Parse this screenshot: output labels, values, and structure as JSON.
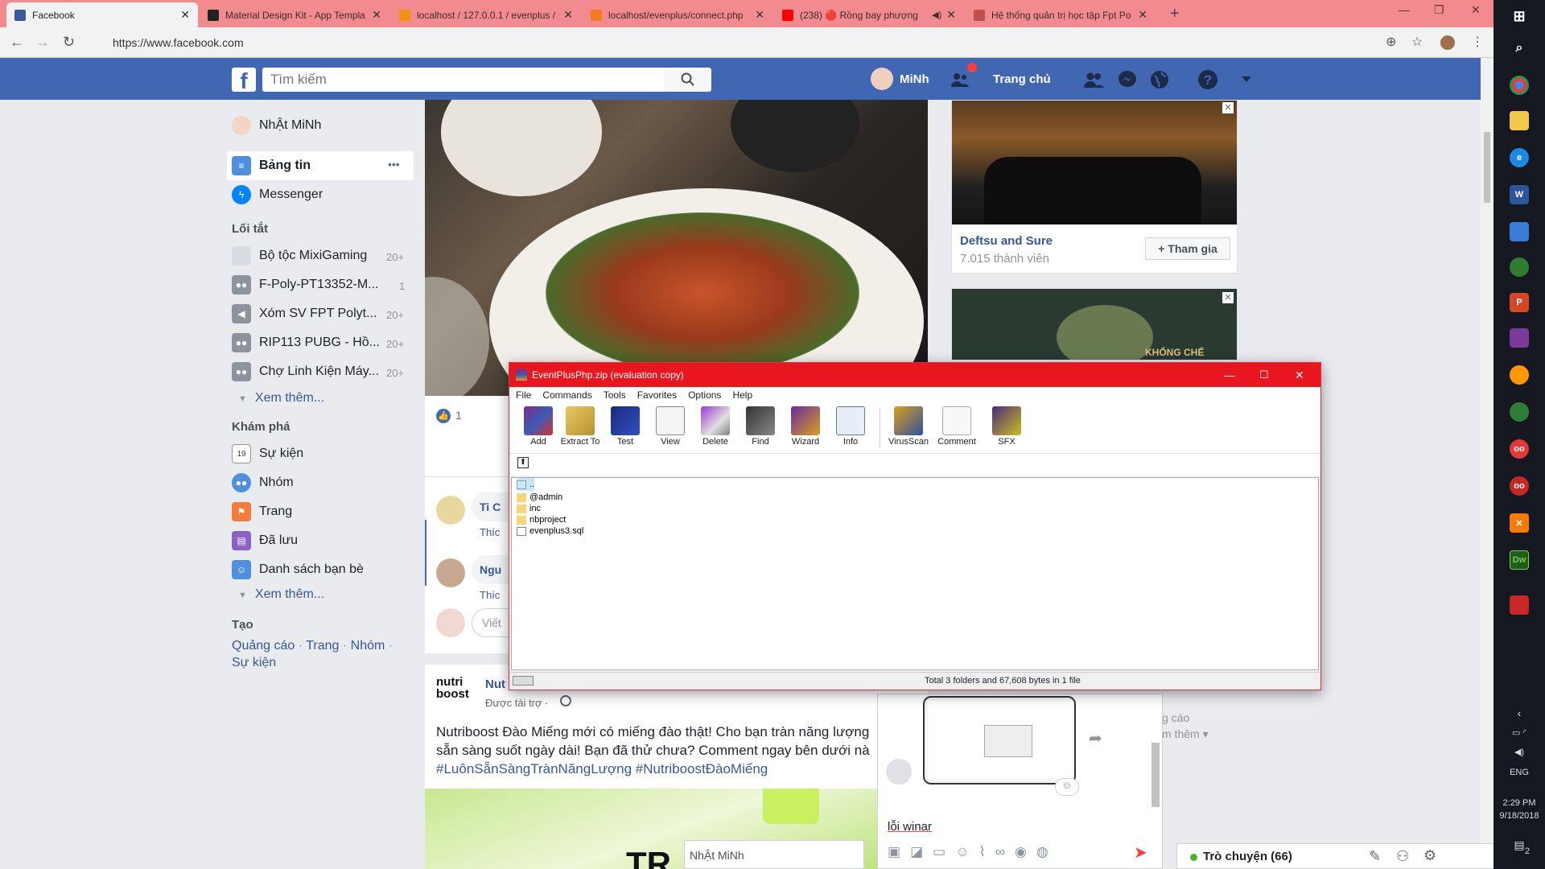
{
  "browser": {
    "tabs": [
      {
        "title": "Facebook",
        "color": "#3b5998"
      },
      {
        "title": "Material Design Kit - App Templa",
        "color": "#222222"
      },
      {
        "title": "localhost / 127.0.0.1 / evenplus /",
        "color": "#f29111"
      },
      {
        "title": "localhost/evenplus/connect.php",
        "color": "#f47b20"
      },
      {
        "title": "(238) 🔴 Rồng bay phượng",
        "color": "#ff0000"
      },
      {
        "title": "Hệ thống quản trị học tập Fpt Po",
        "color": "#c0504d"
      }
    ],
    "url": "https://www.facebook.com"
  },
  "fb_header": {
    "logo": "f",
    "search_placeholder": "Tìm kiếm",
    "user_name": "MiNh",
    "home": "Trang chủ"
  },
  "sidebar": {
    "profile_name": "NhẬt MiNh",
    "main_items": [
      {
        "label": "Bảng tin",
        "icon": "news-feed-icon"
      },
      {
        "label": "Messenger",
        "icon": "messenger-icon"
      }
    ],
    "more_dots": "•••",
    "shortcuts_title": "Lối tắt",
    "shortcuts": [
      {
        "label": "Bộ tộc MixiGaming",
        "count": "20+"
      },
      {
        "label": "F-Poly-PT13352-M...",
        "count": "1"
      },
      {
        "label": "Xóm SV FPT Polyt...",
        "count": "20+"
      },
      {
        "label": "RIP113 PUBG - Hồ...",
        "count": "20+"
      },
      {
        "label": "Chợ Linh Kiện Máy...",
        "count": "20+"
      }
    ],
    "see_more": "Xem thêm...",
    "explore_title": "Khám phá",
    "explore": [
      {
        "label": "Sự kiện",
        "icon": "calendar-icon"
      },
      {
        "label": "Nhóm",
        "icon": "groups-icon"
      },
      {
        "label": "Trang",
        "icon": "flag-icon"
      },
      {
        "label": "Đã lưu",
        "icon": "saved-icon"
      },
      {
        "label": "Danh sách bạn bè",
        "icon": "friends-list-icon"
      }
    ],
    "see_more2": "Xem thêm...",
    "create_title": "Tạo",
    "create_links": [
      "Quảng cáo",
      "Trang",
      "Nhóm",
      "Sự kiện"
    ],
    "calendar_day": "19"
  },
  "feed": {
    "likes": "1",
    "comment1_name": "Ti C",
    "comment1_action": "Thíc",
    "comment2_name": "Ngu",
    "comment2_action": "Thíc",
    "write_comment": "Viết",
    "sponsor_logo": "nutri boost",
    "sponsor_name": "Nut",
    "sponsored": "Được tài trợ ·",
    "ad_text": "Nutriboost Đào Miếng mới có miếng đào thật! Cho bạn tràn năng lượng",
    "ad_text2": "sẵn sàng suốt ngày dài! Bạn đã thử chưa? Comment ngay bên dưới nà",
    "ad_tags": "#LuônSẵnSàngTrànNăngLượng #NutriboostĐàoMiếng",
    "ad_overlay": "TR"
  },
  "right_col": {
    "group1_name": "Deftsu and Sure",
    "group1_members": "7.015 thành viên",
    "join": "+ Tham gia",
    "ad2_caption": "KHỐNG CHẾ",
    "footer1": "g cáo",
    "footer2": "m thêm ▾"
  },
  "chat": {
    "message": "lỗi winar",
    "popup_name": "NhẬt MiNh",
    "list_label": "Trò chuyện (66)"
  },
  "winrar": {
    "title": "EventPlusPhp.zip (evaluation copy)",
    "menu": [
      "File",
      "Commands",
      "Tools",
      "Favorites",
      "Options",
      "Help"
    ],
    "tools": [
      "Add",
      "Extract To",
      "Test",
      "View",
      "Delete",
      "Find",
      "Wizard",
      "Info",
      "VirusScan",
      "Comment",
      "SFX"
    ],
    "files": [
      "..",
      "@admin",
      "inc",
      "nbproject",
      "evenplus3.sql"
    ],
    "status": "Total 3 folders and 67,608 bytes in 1 file"
  },
  "taskbar": {
    "lang": "ENG",
    "time": "2:29 PM",
    "date": "9/18/2018",
    "notif": "2"
  }
}
